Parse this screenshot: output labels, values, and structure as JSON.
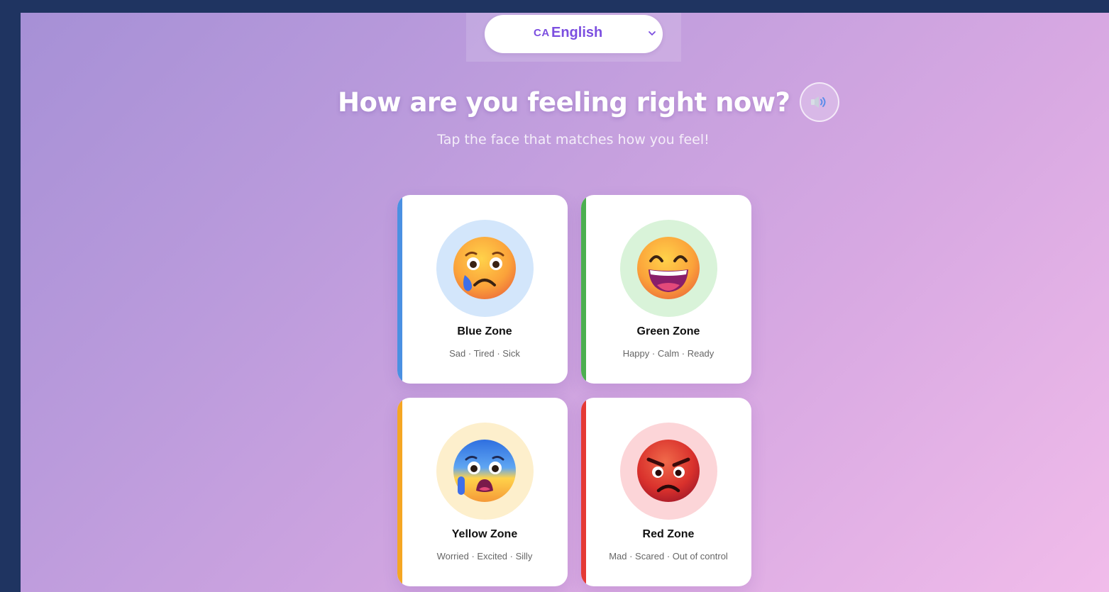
{
  "language": {
    "flag": "CA",
    "selected": "English"
  },
  "header": {
    "title": "How are you feeling right now?",
    "subtitle": "Tap the face that matches how you feel!"
  },
  "colors": {
    "accent": "#7c4fe0",
    "blue_zone": "#4a90e2",
    "green_zone": "#4caf50",
    "yellow_zone": "#f5a623",
    "red_zone": "#e53935"
  },
  "zones": [
    {
      "name": "Blue Zone",
      "feelings": "Sad · Tired · Sick",
      "icon": "sad-tear-face-icon",
      "color": "#4a90e2",
      "bg": "#d3e6fb"
    },
    {
      "name": "Green Zone",
      "feelings": "Happy · Calm · Ready",
      "icon": "grinning-face-icon",
      "color": "#4caf50",
      "bg": "#d9f3d9"
    },
    {
      "name": "Yellow Zone",
      "feelings": "Worried · Excited · Silly",
      "icon": "anxious-sweat-face-icon",
      "color": "#f5a623",
      "bg": "#fdefcc"
    },
    {
      "name": "Red Zone",
      "feelings": "Mad · Scared · Out of control",
      "icon": "angry-face-icon",
      "color": "#e53935",
      "bg": "#fcd5d8"
    }
  ]
}
